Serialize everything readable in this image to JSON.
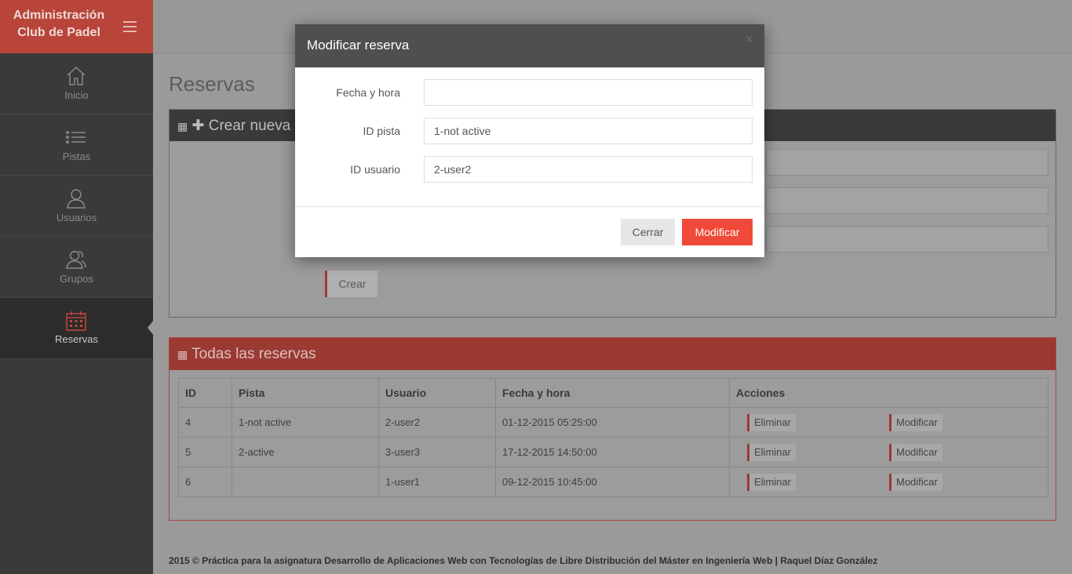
{
  "sidebar": {
    "brand_line1": "Administración",
    "brand_line2": "Club de Padel",
    "items": [
      {
        "label": "Inicio",
        "icon": "home-icon"
      },
      {
        "label": "Pistas",
        "icon": "list-icon"
      },
      {
        "label": "Usuarios",
        "icon": "user-icon"
      },
      {
        "label": "Grupos",
        "icon": "group-icon"
      },
      {
        "label": "Reservas",
        "icon": "calendar-icon",
        "active": true
      }
    ]
  },
  "main": {
    "title": "Reservas",
    "create_panel": {
      "heading": "Crear nueva re",
      "create_button": "Crear"
    },
    "list_panel": {
      "heading": "Todas las reservas",
      "columns": [
        "ID",
        "Pista",
        "Usuario",
        "Fecha y hora",
        "Acciones"
      ],
      "rows": [
        {
          "id": "4",
          "pista": "1-not active",
          "usuario": "2-user2",
          "fecha": "01-12-2015 05:25:00"
        },
        {
          "id": "5",
          "pista": "2-active",
          "usuario": "3-user3",
          "fecha": "17-12-2015 14:50:00"
        },
        {
          "id": "6",
          "pista": "",
          "usuario": "1-user1",
          "fecha": "09-12-2015 10:45:00"
        }
      ],
      "delete_label": "Eliminar",
      "modify_label": "Modificar"
    }
  },
  "footer": {
    "text": "2015 © Práctica para la asignatura Desarrollo de Aplicaciones Web con Tecnologías de Libre Distribución del Máster en Ingeniería Web | Raquel Díaz González"
  },
  "modal": {
    "title": "Modificar reserva",
    "close_symbol": "×",
    "fields": {
      "fecha_label": "Fecha y hora",
      "fecha_value": "",
      "pista_label": "ID pista",
      "pista_value": "1-not active",
      "usuario_label": "ID usuario",
      "usuario_value": "2-user2"
    },
    "cerrar_label": "Cerrar",
    "modificar_label": "Modificar"
  },
  "colors": {
    "brand": "#b8443a",
    "accent": "#f0493a",
    "sidebar": "#3a3a3a"
  }
}
